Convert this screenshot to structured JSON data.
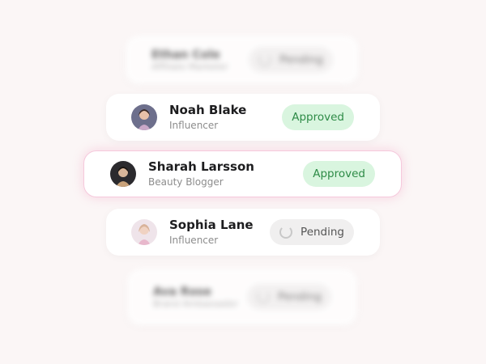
{
  "rows": [
    {
      "name": "Ethan Cole",
      "role": "Affiliate Marketer",
      "status": "Pending"
    },
    {
      "name": "Noah Blake",
      "role": "Influencer",
      "status": "Approved"
    },
    {
      "name": "Sharah Larsson",
      "role": "Beauty Blogger",
      "status": "Approved"
    },
    {
      "name": "Sophia Lane",
      "role": "Influencer",
      "status": "Pending"
    },
    {
      "name": "Ava Rose",
      "role": "Brand Ambassador",
      "status": "Pending"
    }
  ],
  "colors": {
    "approved_bg": "#d9f5df",
    "approved_text": "#2e8b47",
    "pending_bg": "#f0efef",
    "highlight_border": "#f6c9dc"
  }
}
